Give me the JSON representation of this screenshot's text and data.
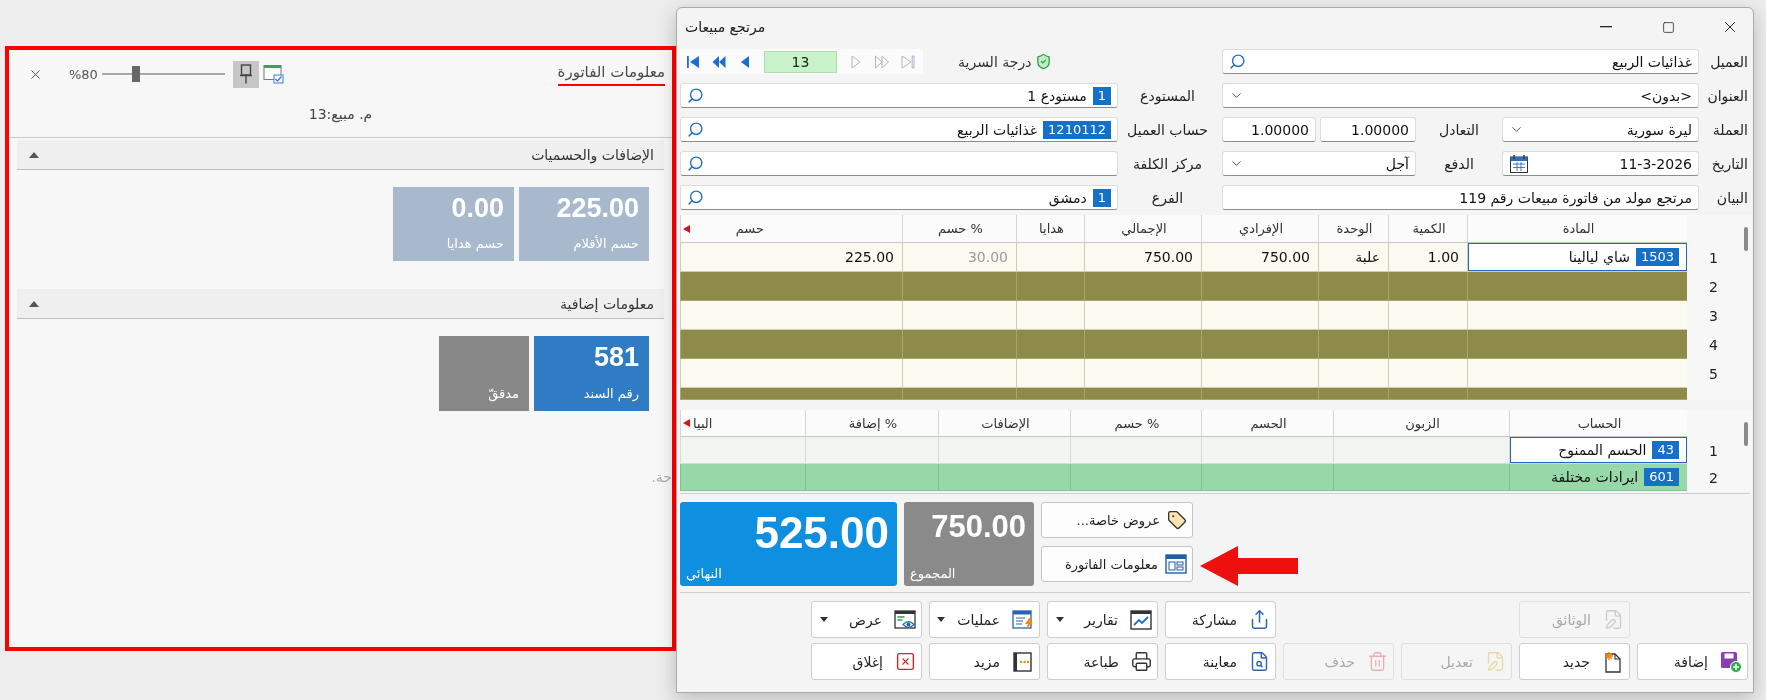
{
  "info_panel": {
    "title": "معلومات الفاتورة",
    "pinned": true,
    "zoom": {
      "level": 0.26,
      "reading": "%80"
    },
    "subtitle": "م. مبيع:13",
    "sections": [
      {
        "title": "الإضافات والحسميات",
        "expanded": true,
        "tiles": [
          {
            "value": "225.00",
            "label": "حسم الأقلام",
            "color": "#a9b9cd"
          },
          {
            "value": "0.00",
            "label": "حسم هدايا",
            "color": "#a9b9cd"
          }
        ]
      },
      {
        "title": "معلومات إضافية",
        "expanded": true,
        "tiles": [
          {
            "value": "581",
            "label": "رقم السند",
            "color": "#2f7bc4"
          },
          {
            "label": "مدققّ",
            "color": "#888888"
          }
        ]
      }
    ],
    "hint": "حة."
  },
  "window": {
    "title": "مرتجع مبيعات"
  },
  "header_form": {
    "navigator": {
      "record": "13",
      "buttons": [
        {
          "disabled": false
        },
        {
          "disabled": false
        },
        {
          "disabled": false
        },
        {
          "disabled": true
        },
        {
          "disabled": true
        },
        {
          "disabled": true
        }
      ]
    },
    "security_level": {
      "label": "درجة السرية"
    },
    "customer": {
      "label": "العميل",
      "value": "غذائيات الربيع"
    },
    "address": {
      "label": "العنوان",
      "value": "<بدون>"
    },
    "currency": {
      "label": "العملة",
      "value": "ليرة سورية"
    },
    "exchange_rate": {
      "label": "التعادل",
      "values": [
        "1.00000",
        "1.00000"
      ]
    },
    "date": {
      "label": "التاريخ",
      "value": "11-3-2026"
    },
    "payment": {
      "label": "الدفع",
      "value": "آجل"
    },
    "statement": {
      "label": "البيان",
      "value": "مرتجع مولد من فاتورة مبيعات رقم 119"
    },
    "warehouse": {
      "label": "المستودع",
      "code": "1",
      "value": "مستودع 1"
    },
    "customer_account": {
      "label": "حساب العميل",
      "code": "1210112",
      "value": "غذائيات الربيع"
    },
    "cost_center": {
      "label": "مركز الكلفة"
    },
    "branch": {
      "label": "الفرع",
      "code": "1",
      "value": "دمشق"
    }
  },
  "items_grid": {
    "columns": [
      "المادة",
      "الكمية",
      "الوحدة",
      "الإفرادي",
      "الإجمالي",
      "هدايا",
      "حسم %",
      "حسم"
    ],
    "rows": [
      {
        "number": "1",
        "selected": true,
        "item_code": "1503",
        "item_name": "شاي ليالينا",
        "quantity": "1.00",
        "unit": "علبة",
        "unit_price": "750.00",
        "total": "750.00",
        "discount_percent": "30.00",
        "discount": "225.00"
      },
      {
        "number": "2",
        "selected": false
      },
      {
        "number": "3",
        "selected": false
      },
      {
        "number": "4",
        "selected": false
      },
      {
        "number": "5",
        "selected": false
      }
    ]
  },
  "accounts_grid": {
    "columns": [
      "الحساب",
      "الزبون",
      "الحسم",
      "حسم %",
      "الإضافات",
      "إضافة %",
      "البيا"
    ],
    "rows": [
      {
        "number": "1",
        "selected": true,
        "account_code": "43",
        "account_name": "الحسم الممنوح"
      },
      {
        "number": "2",
        "selected": false,
        "account_code": "601",
        "account_name": "ايرادات مختلفة"
      }
    ]
  },
  "side_buttons": [
    {
      "label": "عروض خاصة..."
    },
    {
      "label": "معلومات الفاتورة"
    }
  ],
  "totals": [
    {
      "label": "المجموع",
      "value": "750.00",
      "color": "#8a8a8a"
    },
    {
      "label": "النهائي",
      "value": "525.00",
      "color": "#0e8fdf"
    }
  ],
  "toolbar_rows": [
    {
      "buttons": [
        {
          "label": "الوثائق",
          "disabled": true,
          "menu": false
        },
        {
          "label": "مشاركة",
          "disabled": false,
          "menu": false
        },
        {
          "label": "تقارير",
          "disabled": false,
          "menu": true
        },
        {
          "label": "عمليات",
          "disabled": false,
          "menu": true
        },
        {
          "label": "عرض",
          "disabled": false,
          "menu": true
        }
      ]
    },
    {
      "buttons": [
        {
          "label": "إضافة",
          "disabled": false,
          "menu": false
        },
        {
          "label": "جديد",
          "disabled": false,
          "menu": false
        },
        {
          "label": "تعديل",
          "disabled": true,
          "menu": false
        },
        {
          "label": "حذف",
          "disabled": true,
          "menu": false
        },
        {
          "label": "معاينة",
          "disabled": false,
          "menu": false
        },
        {
          "label": "طباعة",
          "disabled": false,
          "menu": false
        },
        {
          "label": "مزيد",
          "disabled": false,
          "menu": false
        },
        {
          "label": "إغلاق",
          "disabled": false,
          "menu": false
        }
      ]
    }
  ]
}
